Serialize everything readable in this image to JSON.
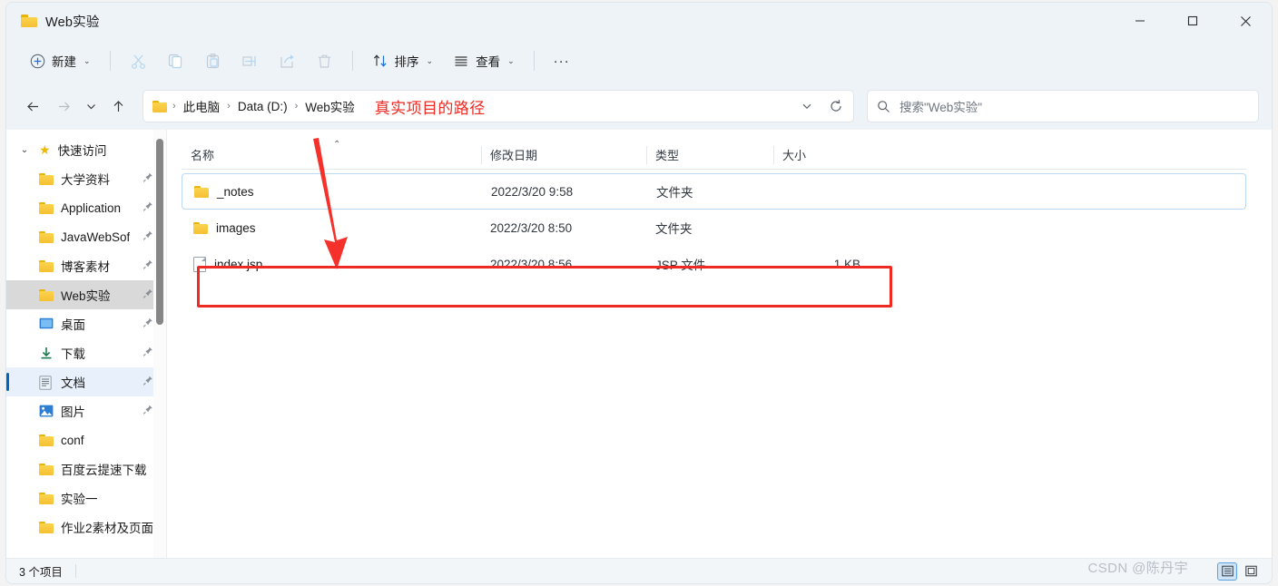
{
  "window": {
    "title": "Web实验",
    "folder_icon": "folder-icon",
    "minimize": "—",
    "maximize": "▢",
    "close": "✕"
  },
  "toolbar": {
    "new_label": "新建",
    "new_icon": "plus-circle-icon",
    "cut_icon": "scissors-icon",
    "copy_icon": "copy-icon",
    "paste_icon": "paste-icon",
    "rename_icon": "rename-icon",
    "share_icon": "share-icon",
    "delete_icon": "trash-icon",
    "sort_label": "排序",
    "sort_icon": "sort-arrows-icon",
    "view_label": "查看",
    "view_icon": "list-lines-icon",
    "more_label": "···",
    "chevron": "⌄"
  },
  "nav": {
    "back_icon": "arrow-left-icon",
    "forward_icon": "arrow-right-icon",
    "recent_icon": "chevron-down-icon",
    "up_icon": "arrow-up-icon",
    "refresh_icon": "refresh-icon",
    "dropdown_icon": "chevron-down-icon"
  },
  "breadcrumb": {
    "folder_icon": "folder-icon",
    "separator": "›",
    "items": [
      "此电脑",
      "Data (D:)",
      "Web实验"
    ],
    "annotation": "真实项目的路径"
  },
  "search": {
    "icon": "search-icon",
    "placeholder": "搜索\"Web实验\""
  },
  "sidebar": {
    "header": {
      "label": "快速访问",
      "icon": "star-icon",
      "caret": "⌄"
    },
    "items": [
      {
        "label": "大学资料",
        "icon": "folder-icon",
        "pinned": true,
        "state": "normal"
      },
      {
        "label": "Application",
        "icon": "folder-icon",
        "pinned": true,
        "state": "normal"
      },
      {
        "label": "JavaWebSof",
        "icon": "folder-icon",
        "pinned": true,
        "state": "normal"
      },
      {
        "label": "博客素材",
        "icon": "folder-icon",
        "pinned": true,
        "state": "normal"
      },
      {
        "label": "Web实验",
        "icon": "folder-icon",
        "pinned": true,
        "state": "selected"
      },
      {
        "label": "桌面",
        "icon": "desktop-icon",
        "pinned": true,
        "state": "normal"
      },
      {
        "label": "下载",
        "icon": "download-icon",
        "pinned": true,
        "state": "normal"
      },
      {
        "label": "文档",
        "icon": "document-icon",
        "pinned": true,
        "state": "active"
      },
      {
        "label": "图片",
        "icon": "picture-icon",
        "pinned": true,
        "state": "normal"
      },
      {
        "label": "conf",
        "icon": "folder-icon",
        "pinned": false,
        "state": "normal"
      },
      {
        "label": "百度云提速下载",
        "icon": "folder-icon",
        "pinned": false,
        "state": "normal"
      },
      {
        "label": "实验一",
        "icon": "folder-icon",
        "pinned": false,
        "state": "normal"
      },
      {
        "label": "作业2素材及页面",
        "icon": "folder-icon",
        "pinned": false,
        "state": "normal"
      }
    ]
  },
  "filelist": {
    "columns": [
      "名称",
      "修改日期",
      "类型",
      "大小"
    ],
    "sort_indicator": "⌃",
    "rows": [
      {
        "name": "_notes",
        "icon": "folder-icon",
        "date": "2022/3/20 9:58",
        "type": "文件夹",
        "size": "",
        "focused": true,
        "highlighted": false
      },
      {
        "name": "images",
        "icon": "folder-icon",
        "date": "2022/3/20 8:50",
        "type": "文件夹",
        "size": "",
        "focused": false,
        "highlighted": false
      },
      {
        "name": "index.jsp",
        "icon": "file-icon",
        "date": "2022/3/20 8:56",
        "type": "JSP 文件",
        "size": "1 KB",
        "focused": false,
        "highlighted": true
      }
    ]
  },
  "status": {
    "item_count": "3 个项目",
    "details_view_icon": "details-view-icon",
    "tiles_view_icon": "tiles-view-icon"
  },
  "watermark": "CSDN @陈丹宇",
  "colors": {
    "accent": "#0067c0",
    "annotation_red": "#ee2a23",
    "folder_yellow": "#f5c034",
    "chrome_bg": "#eef3f8"
  }
}
